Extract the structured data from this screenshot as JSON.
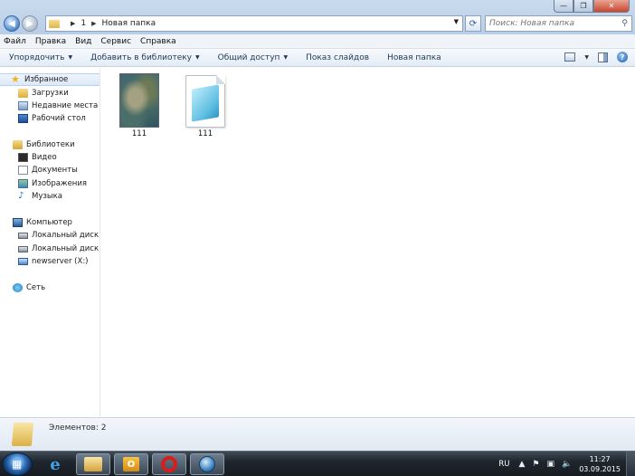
{
  "window": {
    "controls": {
      "minimize": "—",
      "maximize": "❐",
      "close": "✕"
    }
  },
  "address_bar": {
    "crumbs": [
      "1",
      "Новая папка"
    ],
    "search_placeholder": "Поиск: Новая папка"
  },
  "menu": [
    "Файл",
    "Правка",
    "Вид",
    "Сервис",
    "Справка"
  ],
  "command_bar": {
    "organize": "Упорядочить",
    "add_to_library": "Добавить в библиотеку",
    "share": "Общий доступ",
    "slideshow": "Показ слайдов",
    "new_folder": "Новая папка"
  },
  "sidebar": {
    "favorites": {
      "label": "Избранное",
      "items": [
        "Загрузки",
        "Недавние места",
        "Рабочий стол"
      ]
    },
    "libraries": {
      "label": "Библиотеки",
      "items": [
        "Видео",
        "Документы",
        "Изображения",
        "Музыка"
      ]
    },
    "computer": {
      "label": "Компьютер",
      "items": [
        "Локальный диск (C",
        "Локальный диск (D",
        "newserver (X:)"
      ]
    },
    "network": {
      "label": "Сеть"
    }
  },
  "files": [
    {
      "name": "111",
      "type": "image"
    },
    {
      "name": "111",
      "type": "text"
    }
  ],
  "details": {
    "count_text": "Элементов: 2"
  },
  "taskbar": {
    "language": "RU",
    "time": "11:27",
    "date": "03.09.2015"
  },
  "colors": {
    "accent": "#1e395b",
    "selected_bg": "#dde9f8",
    "taskbar": "#1f262d"
  }
}
